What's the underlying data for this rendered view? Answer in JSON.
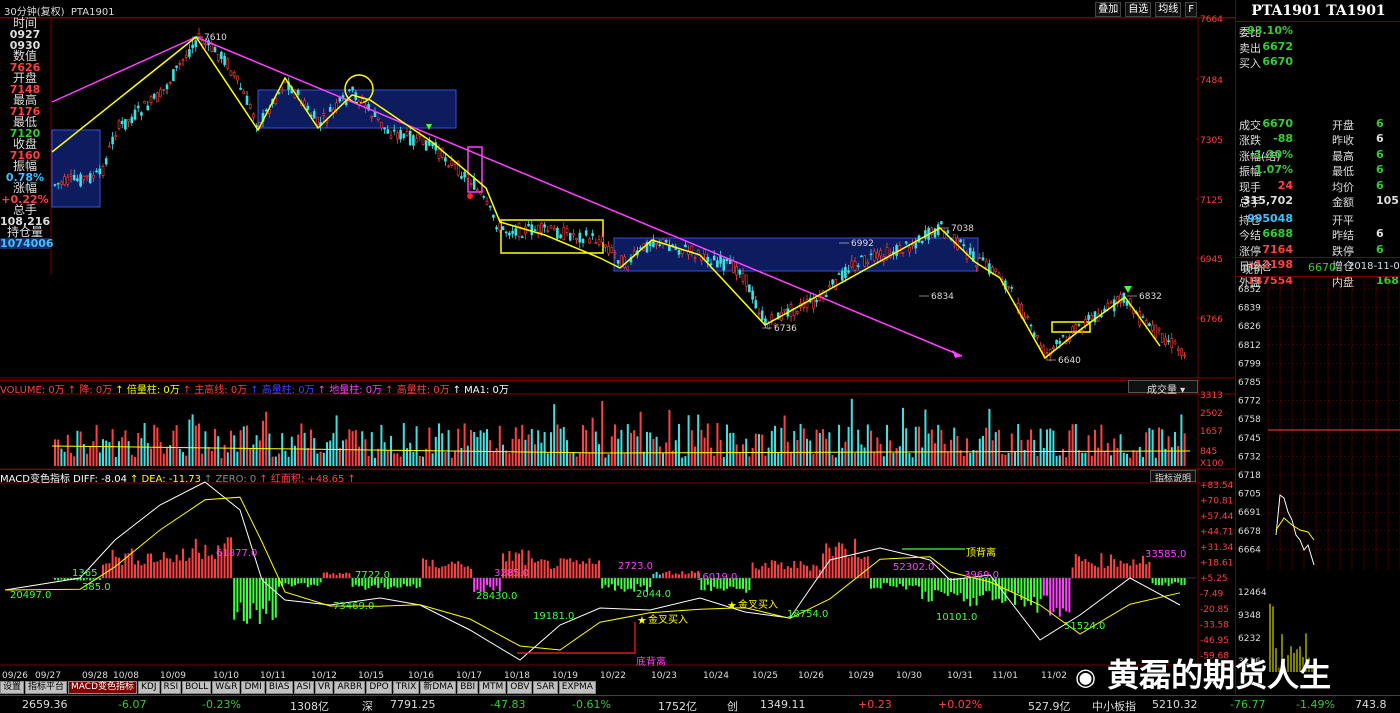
{
  "window": {
    "title_prefix": "30分钟(复权)",
    "symbol": "PTA1901",
    "toolbar_buttons": [
      "叠加",
      "自选",
      "均线",
      "F"
    ]
  },
  "left_info": [
    {
      "label": "时间",
      "value": "0927",
      "value2": "0930",
      "color": "w"
    },
    {
      "label": "数值",
      "value": "7626",
      "color": "r"
    },
    {
      "label": "开盘",
      "value": "7148",
      "color": "r"
    },
    {
      "label": "最高",
      "value": "7176",
      "color": "r"
    },
    {
      "label": "最低",
      "value": "7120",
      "color": "g"
    },
    {
      "label": "收盘",
      "value": "7160",
      "color": "r"
    },
    {
      "label": "振幅",
      "value": "0.78%",
      "color": "c"
    },
    {
      "label": "涨幅",
      "value": "+0.22%",
      "color": "r"
    },
    {
      "label": "总手",
      "value": "108,216",
      "color": "w"
    },
    {
      "label": "持仓量",
      "value": "1074006",
      "color": "c"
    }
  ],
  "price_axis": [
    "7664",
    "7484",
    "7305",
    "7125",
    "6945",
    "6766"
  ],
  "price_annotations": [
    "7610",
    "7038",
    "6992",
    "6834",
    "6832",
    "6736",
    "6640"
  ],
  "volume_bar": {
    "items": [
      {
        "text": "VOLUME: 0万",
        "color": "#ff4040"
      },
      {
        "text": "↑ 降: 0万",
        "color": "#ff4040"
      },
      {
        "text": "↑ 倍量柱: 0万",
        "color": "#ffff00"
      },
      {
        "text": "↑ 主高线: 0万",
        "color": "#ff4040"
      },
      {
        "text": "↑ 高量柱: 0万",
        "color": "#4040ff"
      },
      {
        "text": "↑ 地量柱: 0万",
        "color": "#ff40ff"
      },
      {
        "text": "↑ 高量柱: 0万",
        "color": "#ff4040"
      },
      {
        "text": "↑ MA1: 0万",
        "color": "#ffffff"
      }
    ],
    "selector": "成交量",
    "axis": [
      "3313",
      "2502",
      "1657",
      "845",
      "X100"
    ]
  },
  "macd_bar": {
    "items": [
      {
        "text": "MACD变色指标 DIFF: -8.04",
        "color": "#ffffff"
      },
      {
        "text": "↑ DEA: -11.73",
        "color": "#ffff00"
      },
      {
        "text": "↑ ZERO: 0",
        "color": "#888888"
      },
      {
        "text": "↑ 红面积: +48.65",
        "color": "#ff4040"
      },
      {
        "text": "↑",
        "color": "#ff4040"
      }
    ],
    "button": "指标说明",
    "axis": [
      "+83.54",
      "+70.81",
      "+57.44",
      "+44.71",
      "+31.34",
      "+18.61",
      "+5.25",
      "-7.49",
      "-20.85",
      "-33.58",
      "-46.95",
      "-59.68"
    ],
    "labels": [
      "61877.0",
      "1365",
      "385.0",
      "20497.0",
      "7722.0",
      "73469.0",
      "3285.0",
      "28430.0",
      "19181.0",
      "2723.0",
      "2044.0",
      "16019.0",
      "18754.0",
      "52302.0",
      "3969.0",
      "10101.0",
      "51524.0",
      "33585.0"
    ],
    "annotations": {
      "jinchai1": "金叉买入",
      "jinchai2": "金叉买入",
      "dibeili": "底背离",
      "dingbeili": "顶背离"
    }
  },
  "dates": [
    "09/26",
    "09/27",
    "09/28",
    "10/08",
    "10/09",
    "10/10",
    "10/11",
    "10/12",
    "10/15",
    "10/16",
    "10/17",
    "10/18",
    "10/19",
    "10/22",
    "10/23",
    "10/24",
    "10/25",
    "10/26",
    "10/29",
    "10/30",
    "10/31",
    "11/01",
    "11/02"
  ],
  "tabs": [
    "设置",
    "指标平台",
    "MACD变色指标",
    "KDJ",
    "RSI",
    "BOLL",
    "W&R",
    "DMI",
    "BIAS",
    "ASI",
    "VR",
    "ARBR",
    "DPO",
    "TRIX",
    "新DMA",
    "BBI",
    "MTM",
    "OBV",
    "SAR",
    "EXPMA"
  ],
  "status": [
    {
      "text": "2659.36",
      "color": "#ddd"
    },
    {
      "text": "-6.07",
      "color": "#3c3"
    },
    {
      "text": "-0.23%",
      "color": "#3c3"
    },
    {
      "text": "1308亿",
      "color": "#ddd"
    },
    {
      "text": "深",
      "color": "#ddd"
    },
    {
      "text": "7791.25",
      "color": "#ddd"
    },
    {
      "text": "-47.83",
      "color": "#3c3"
    },
    {
      "text": "-0.61%",
      "color": "#3c3"
    },
    {
      "text": "1752亿",
      "color": "#ddd"
    },
    {
      "text": "创",
      "color": "#ddd"
    },
    {
      "text": "1349.11",
      "color": "#ddd"
    },
    {
      "text": "+0.23",
      "color": "#ff4040"
    },
    {
      "text": "+0.02%",
      "color": "#ff4040"
    },
    {
      "text": "527.9亿",
      "color": "#ddd"
    },
    {
      "text": "中小板指",
      "color": "#ddd"
    },
    {
      "text": "5210.32",
      "color": "#ddd"
    },
    {
      "text": "-76.77",
      "color": "#3c3"
    },
    {
      "text": "-1.49%",
      "color": "#3c3"
    },
    {
      "text": "743.8",
      "color": "#ddd"
    }
  ],
  "right_panel": {
    "title": "PTA1901 TA1901",
    "rows": [
      {
        "k": "委比",
        "v": "-93.10%",
        "vc": "grn"
      },
      {
        "k": "卖出",
        "v": "6672",
        "vc": "grn"
      },
      {
        "k": "买入",
        "v": "6670",
        "vc": "grn"
      },
      {
        "k": "成交",
        "v": "6670",
        "vc": "grn",
        "k2": "开盘",
        "v2": "6",
        "v2c": "grn"
      },
      {
        "k": "涨跌",
        "v": "-88",
        "vc": "grn",
        "k2": "昨收",
        "v2": "6",
        "v2c": "wht"
      },
      {
        "k": "涨幅(结)",
        "v": "-1.30%",
        "vc": "grn",
        "k2": "最高",
        "v2": "6",
        "v2c": "grn"
      },
      {
        "k": "振幅",
        "v": "1.07%",
        "vc": "grn",
        "k2": "最低",
        "v2": "6",
        "v2c": "grn"
      },
      {
        "k": "现手",
        "v": "24",
        "vc": "red",
        "k2": "均价",
        "v2": "6",
        "v2c": "grn"
      },
      {
        "k": "总手",
        "v": "315,702",
        "vc": "wht",
        "k2": "金额",
        "v2": "105",
        "v2c": "wht"
      },
      {
        "k": "持仓",
        "v": "995048",
        "vc": "cya",
        "k2": "开平",
        "v2": "",
        "v2c": "wht"
      },
      {
        "k": "今结",
        "v": "6688",
        "vc": "grn",
        "k2": "昨结",
        "v2": "6",
        "v2c": "wht"
      },
      {
        "k": "涨停",
        "v": "7164",
        "vc": "red",
        "k2": "跌停",
        "v2": "6",
        "v2c": "grn"
      },
      {
        "k": "日增仓",
        "v": "+12198",
        "vc": "red",
        "k2": "增仓",
        "v2": "",
        "v2c": "wht"
      },
      {
        "k": "外盘",
        "v": "147554",
        "vc": "red",
        "k2": "内盘",
        "v2": "168",
        "v2c": "grn"
      }
    ],
    "xianjia_label": "现价",
    "xianjia_value": "6670",
    "xianjia_date": "2018-11-0",
    "tick_axis": [
      "6852",
      "6839",
      "6826",
      "6812",
      "6799",
      "6785",
      "6772",
      "6758",
      "6745",
      "6732",
      "6718",
      "6705",
      "6691",
      "6678",
      "6664"
    ],
    "tick_vol_axis": [
      "12464",
      "9348",
      "6232",
      "3116"
    ]
  },
  "watermark": "黄磊的期货人生"
}
